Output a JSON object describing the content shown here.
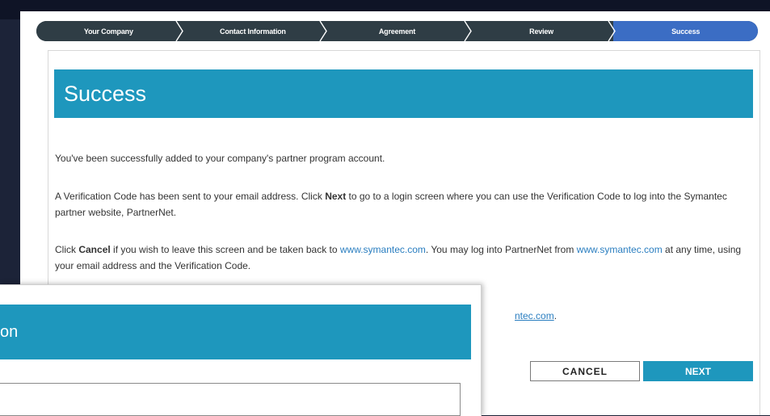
{
  "wizard": {
    "steps": [
      {
        "label": "Your Company"
      },
      {
        "label": "Contact Information"
      },
      {
        "label": "Agreement"
      },
      {
        "label": "Review"
      },
      {
        "label": "Success"
      }
    ],
    "active_step": "Success"
  },
  "success": {
    "title": "Success",
    "para1": "You've been successfully added to your company's partner program account.",
    "para2_before": "A Verification Code has been sent to your email address. Click ",
    "para2_bold": "Next",
    "para2_after": " to go to a login screen where you can use the Verification Code to log into the Symantec partner website, PartnerNet.",
    "para3_before": "Click ",
    "para3_bold": "Cancel",
    "para3_mid": " if you wish to leave this screen and be taken back to ",
    "para3_link1": "www.symantec.com",
    "para3_mid2": ". You may log into PartnerNet from ",
    "para3_link2": "www.symantec.com",
    "para3_after": " at any time, using your email address and the Verification Code.",
    "partial_link": "ntec.com",
    "partial_link_suffix": "."
  },
  "buttons": {
    "cancel": "CANCEL",
    "next": "NEXT"
  },
  "overlay": {
    "title_fragment": "on",
    "field_value": ""
  },
  "colors": {
    "banner": "#1e97bd",
    "wizard_bg": "#2f3d45",
    "wizard_active": "#3b6dc4",
    "link": "#2a7ec0",
    "backdrop": "#1c2338"
  }
}
